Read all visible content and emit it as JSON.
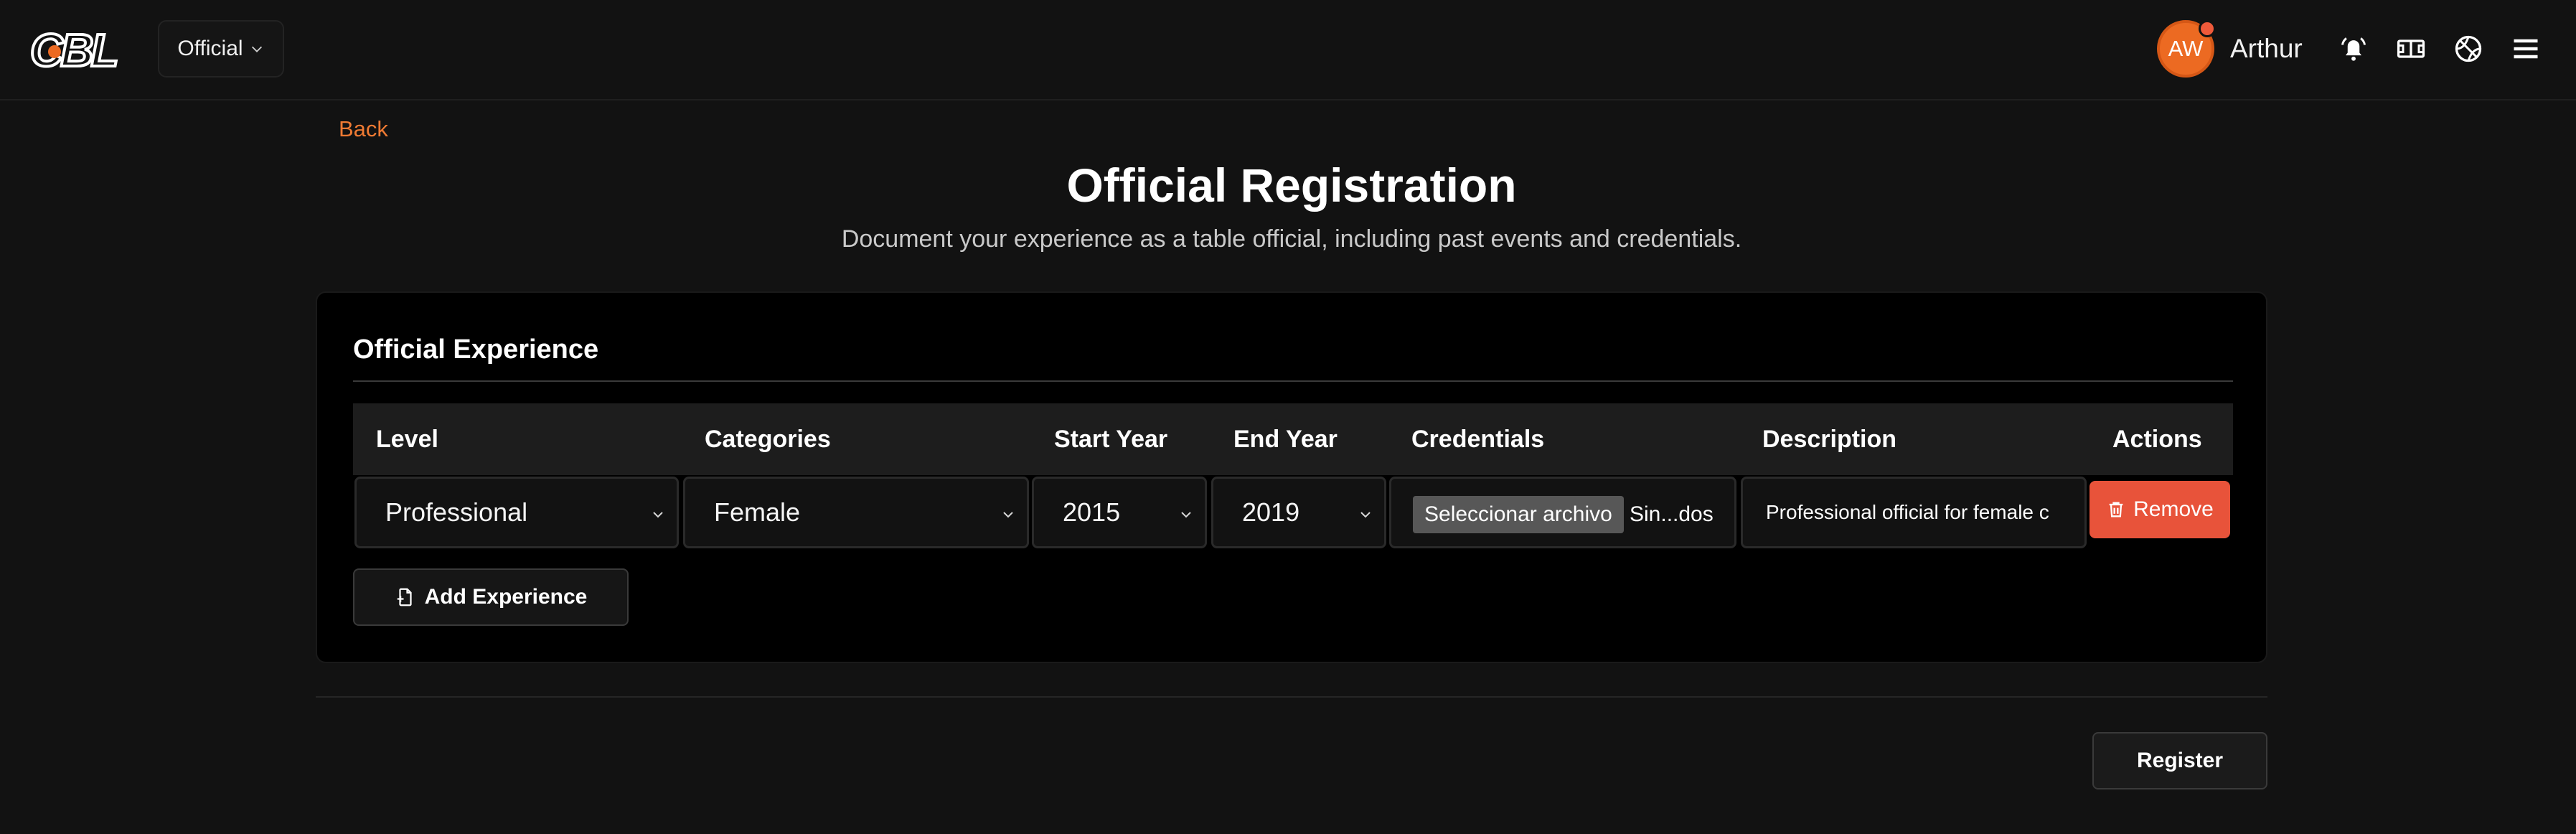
{
  "header": {
    "logo_text": "CBL",
    "role_selector": {
      "value": "Official"
    },
    "user": {
      "initials": "AW",
      "name": "Arthur"
    },
    "icons": [
      "bell-icon",
      "court-icon",
      "ball-icon",
      "menu-icon"
    ]
  },
  "main": {
    "back_label": "Back",
    "title": "Official Registration",
    "subtitle": "Document your experience as a table official, including past events and credentials."
  },
  "experience": {
    "section_title": "Official Experience",
    "columns": [
      "Level",
      "Categories",
      "Start Year",
      "End Year",
      "Credentials",
      "Description",
      "Actions"
    ],
    "rows": [
      {
        "level": "Professional",
        "categories": "Female",
        "start_year": "2015",
        "end_year": "2019",
        "credentials": {
          "button_label": "Seleccionar archivo",
          "file_status": "Sin...dos"
        },
        "description": "Professional official for female c",
        "action_label": "Remove"
      }
    ],
    "add_label": "Add Experience"
  },
  "footer": {
    "register_label": "Register"
  },
  "colors": {
    "background": "#121212",
    "card": "#000000",
    "accent_orange": "#ec6a22",
    "back_link": "#ef7a33",
    "danger": "#e8533a"
  }
}
